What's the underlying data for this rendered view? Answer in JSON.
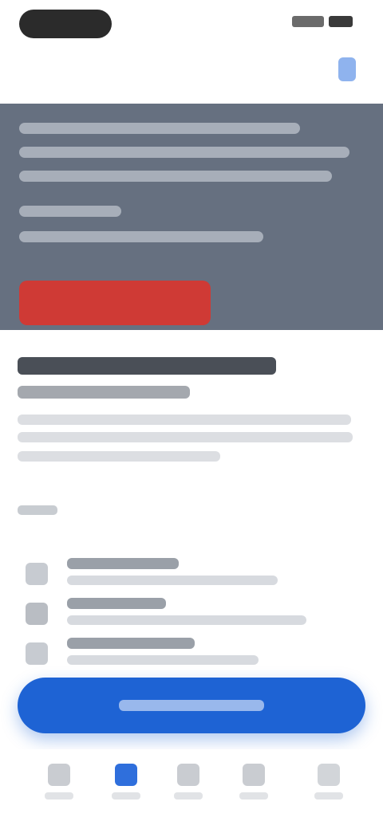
{
  "status_bar": {
    "time": "",
    "battery": ""
  },
  "top_bar": {
    "action_icon": "menu-icon"
  },
  "hero": {
    "headline": "",
    "cta_label": ""
  },
  "article": {
    "title": "",
    "subtitle": "",
    "body": "",
    "section_label": "",
    "items": [
      {
        "icon": "check-icon",
        "title": "",
        "subtitle": ""
      },
      {
        "icon": "document-icon",
        "title": "",
        "subtitle": ""
      },
      {
        "icon": "info-icon",
        "title": "",
        "subtitle": ""
      }
    ]
  },
  "primary_action": {
    "label": ""
  },
  "bottom_nav": {
    "items": [
      {
        "icon": "home-icon",
        "label": ""
      },
      {
        "icon": "compass-icon",
        "label": ""
      },
      {
        "icon": "grid-icon",
        "label": ""
      },
      {
        "icon": "bookmark-icon",
        "label": ""
      },
      {
        "icon": "user-icon",
        "label": ""
      }
    ],
    "active_index": 1
  },
  "colors": {
    "hero_background": "#667080",
    "hero_cta": "#cf3a35",
    "primary_button": "#1e63d4",
    "nav_active": "#2f6fdc"
  }
}
